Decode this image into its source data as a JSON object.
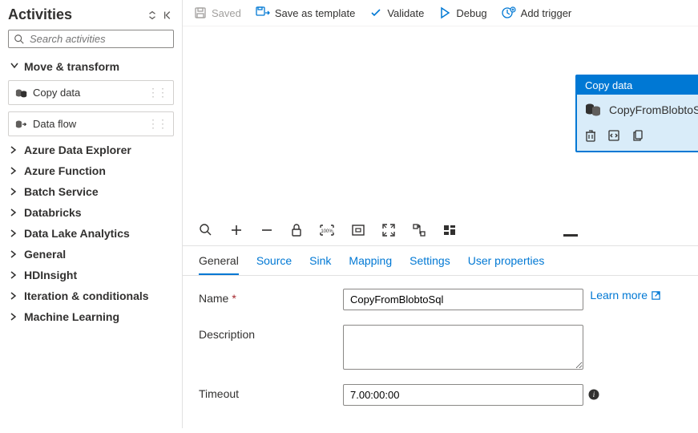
{
  "sidebar": {
    "title": "Activities",
    "search_placeholder": "Search activities",
    "expanded_group": "Move & transform",
    "activities": [
      {
        "label": "Copy data"
      },
      {
        "label": "Data flow"
      }
    ],
    "groups": [
      "Azure Data Explorer",
      "Azure Function",
      "Batch Service",
      "Databricks",
      "Data Lake Analytics",
      "General",
      "HDInsight",
      "Iteration & conditionals",
      "Machine Learning"
    ]
  },
  "toolbar": {
    "saved": "Saved",
    "save_as_template": "Save as template",
    "validate": "Validate",
    "debug": "Debug",
    "add_trigger": "Add trigger"
  },
  "node": {
    "header": "Copy data",
    "name": "CopyFromBlobtoSql"
  },
  "tabs": {
    "general": "General",
    "source": "Source",
    "sink": "Sink",
    "mapping": "Mapping",
    "settings": "Settings",
    "user_properties": "User properties"
  },
  "form": {
    "name_label": "Name",
    "name_value": "CopyFromBlobtoSql",
    "description_label": "Description",
    "description_value": "",
    "timeout_label": "Timeout",
    "timeout_value": "7.00:00:00",
    "learn_more": "Learn more"
  }
}
